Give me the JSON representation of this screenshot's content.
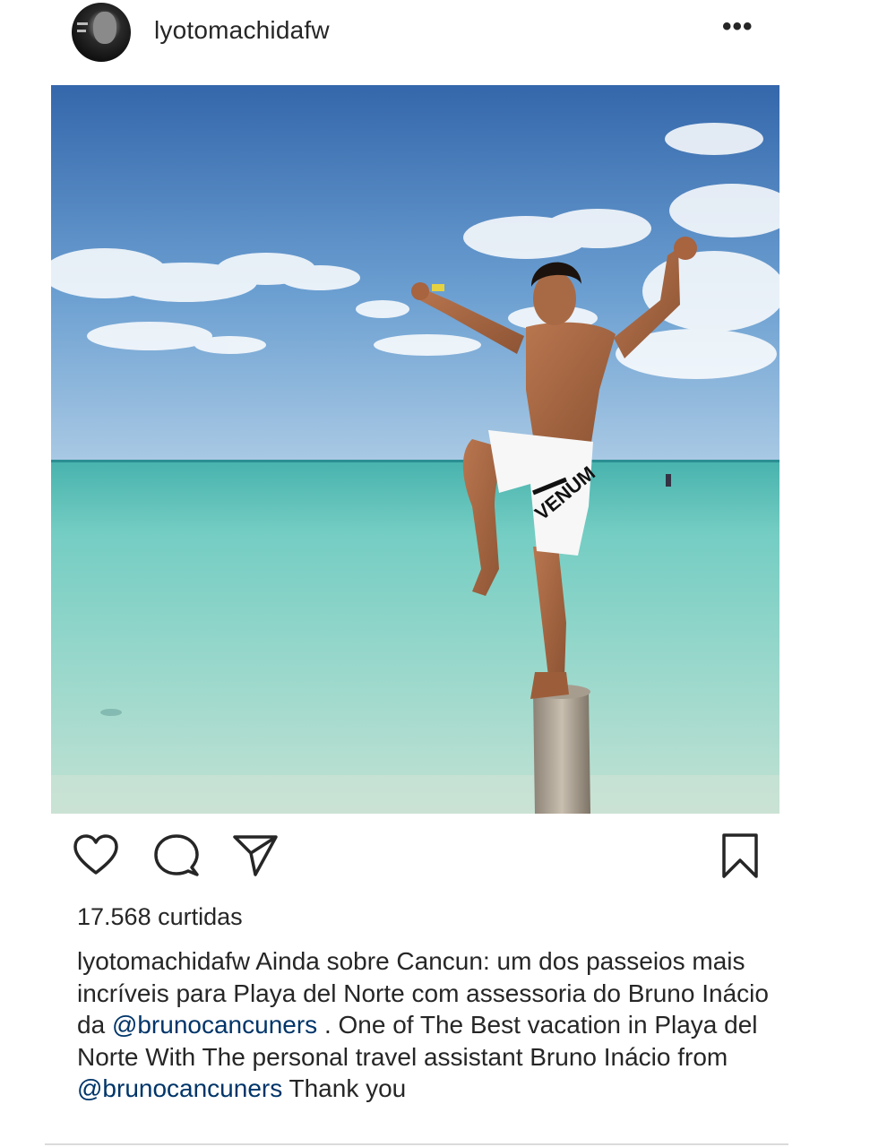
{
  "post": {
    "username": "lyotomachidafw",
    "more_label": "•••",
    "likes_text": "17.568 curtidas",
    "caption": {
      "username": "lyotomachidafw",
      "part1": " Ainda sobre Cancun: um dos passeios mais incríveis para Playa del Norte com assessoria do Bruno Inácio da ",
      "mention1": "@brunocancuners",
      "part2": " . One of The Best vacation in Playa del Norte With The personal travel assistant Bruno Inácio from ",
      "mention2": "@brunocancuners",
      "part3": " Thank you"
    },
    "image": {
      "shorts_text": "VENUM"
    }
  },
  "icons": {
    "like": "heart-icon",
    "comment": "comment-icon",
    "share": "send-icon",
    "save": "bookmark-icon",
    "more": "more-icon"
  },
  "colors": {
    "text": "#262626",
    "mention": "#003569",
    "sky_top": "#3d74b4",
    "sea": "#7fd0c6"
  }
}
